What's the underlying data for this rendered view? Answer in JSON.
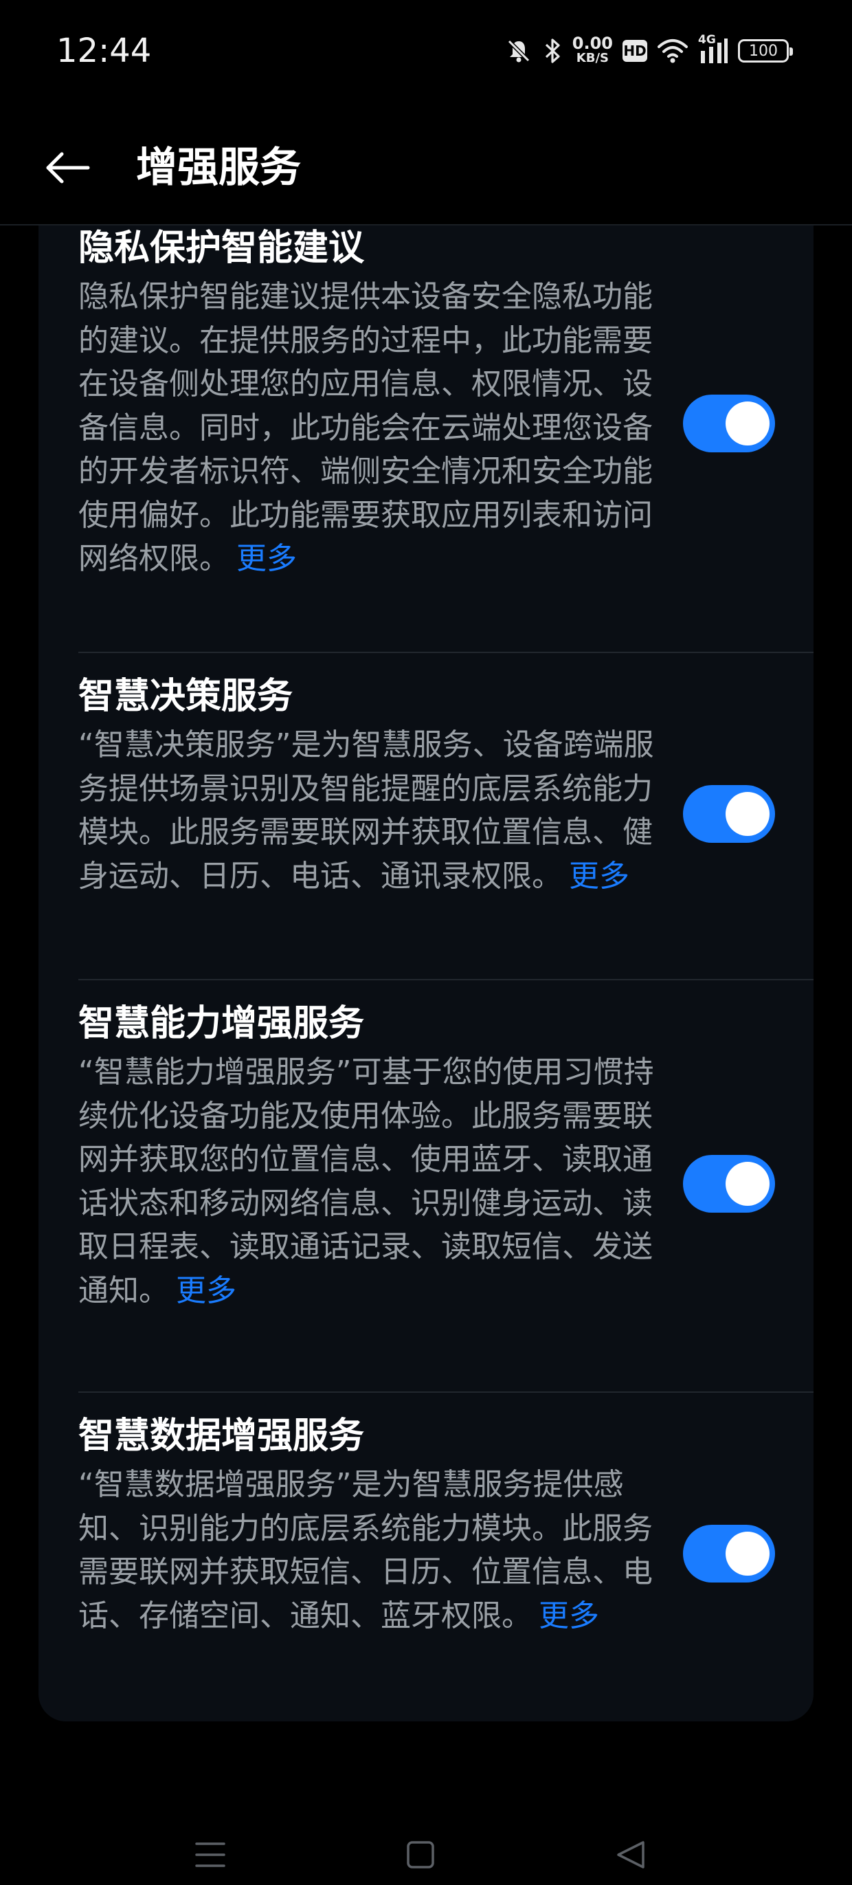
{
  "status_bar": {
    "time": "12:44",
    "network_speed_value": "0.00",
    "network_speed_unit": "KB/S",
    "hd_label": "HD",
    "signal_label": "4G",
    "battery_level": "100"
  },
  "header": {
    "title": "增强服务"
  },
  "items": [
    {
      "title": "隐私保护智能建议",
      "description": "隐私保护智能建议提供本设备安全隐私功能的建议。在提供服务的过程中，此功能需要在设备侧处理您的应用信息、权限情况、设备信息。同时，此功能会在云端处理您设备的开发者标识符、端侧安全情况和安全功能使用偏好。此功能需要获取应用列表和访问网络权限。",
      "more": "更多",
      "enabled": true
    },
    {
      "title": "智慧决策服务",
      "description": "“智慧决策服务”是为智慧服务、设备跨端服务提供场景识别及智能提醒的底层系统能力模块。此服务需要联网并获取位置信息、健身运动、日历、电话、通讯录权限。",
      "more": "更多",
      "enabled": true
    },
    {
      "title": "智慧能力增强服务",
      "description": "“智慧能力增强服务”可基于您的使用习惯持续优化设备功能及使用体验。此服务需要联网并获取您的位置信息、使用蓝牙、读取通话状态和移动网络信息、识别健身运动、读取日程表、读取通话记录、读取短信、发送通知。",
      "more": "更多",
      "enabled": true
    },
    {
      "title": "智慧数据增强服务",
      "description": "“智慧数据增强服务”是为智慧服务提供感知、识别能力的底层系统能力模块。此服务需要联网并获取短信、日历、位置信息、电话、存储空间、通知、蓝牙权限。",
      "more": "更多",
      "enabled": true
    }
  ],
  "colors": {
    "accent": "#1a7cff",
    "background": "#000000",
    "card": "#0a0e14",
    "secondary_text": "#9aa0a6"
  },
  "icons": {
    "back": "arrow-left-icon",
    "mute": "bell-off-icon",
    "bluetooth": "bluetooth-icon",
    "wifi": "wifi-icon",
    "menu": "menu-icon",
    "home": "square-home-icon",
    "back_nav": "triangle-back-icon"
  }
}
